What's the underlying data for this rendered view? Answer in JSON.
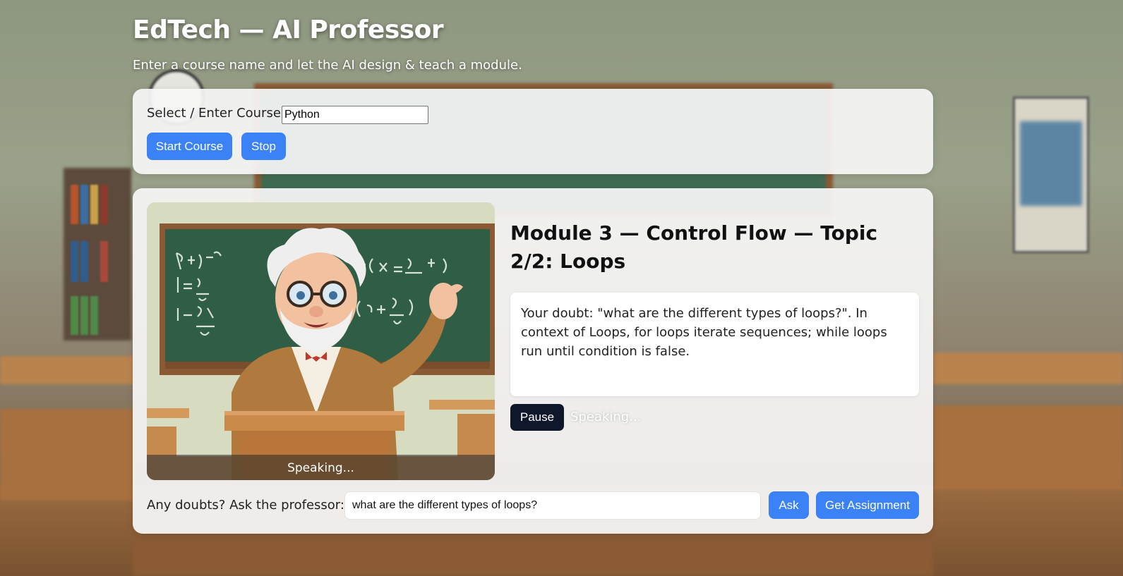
{
  "header": {
    "title": "EdTech — AI Professor",
    "subtitle": "Enter a course name and let the AI design & teach a module."
  },
  "course": {
    "label": "Select / Enter Course:",
    "value": "Python",
    "start_label": "Start Course",
    "stop_label": "Stop"
  },
  "lesson": {
    "avatar_caption": "Speaking...",
    "topic_title": "Module 3 — Control Flow — Topic 2/2: Loops",
    "answer": "Your doubt: \"what are the different types of loops?\". In context of Loops, for loops iterate sequences; while loops run until condition is false.",
    "pause_label": "Pause",
    "status": "Speaking..."
  },
  "doubt": {
    "label": "Any doubts? Ask the professor:",
    "value": "what are the different types of loops?",
    "ask_label": "Ask",
    "assignment_label": "Get Assignment"
  },
  "colors": {
    "primary": "#3b82f6",
    "dark_button": "#0f172a",
    "panel": "#f6f6f6"
  }
}
